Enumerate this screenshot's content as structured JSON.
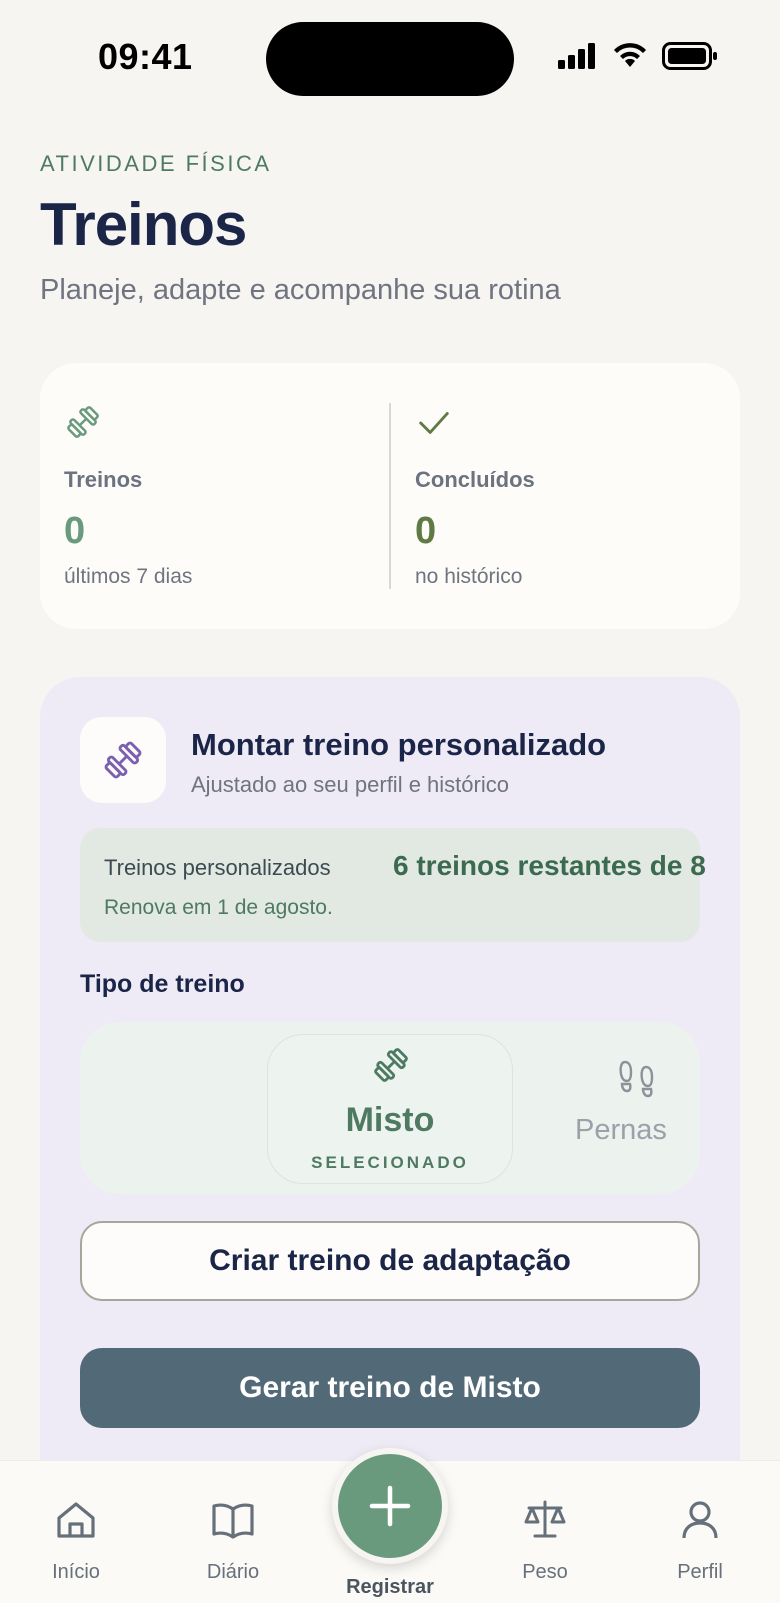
{
  "status_bar": {
    "time": "09:41"
  },
  "header": {
    "eyebrow": "ATIVIDADE FÍSICA",
    "title": "Treinos",
    "subtitle": "Planeje, adapte e acompanhe sua rotina"
  },
  "stats": [
    {
      "icon": "dumbbell-icon",
      "label": "Treinos",
      "value": "0",
      "caption": "últimos 7 dias",
      "color": "#6a9a7e"
    },
    {
      "icon": "check-icon",
      "label": "Concluídos",
      "value": "0",
      "caption": "no histórico",
      "color": "#5f7a44"
    }
  ],
  "builder": {
    "icon": "dumbbell-icon",
    "title": "Montar treino personalizado",
    "subtitle": "Ajustado ao seu perfil e histórico",
    "quota": {
      "label": "Treinos personalizados",
      "value": "6 treinos restantes de 8",
      "renew": "Renova em 1 de agosto."
    },
    "type_heading": "Tipo de treino",
    "types": [
      {
        "name": "Misto",
        "status": "SELECIONADO",
        "icon": "dumbbell-icon",
        "selected": true
      },
      {
        "name": "Pernas",
        "icon": "footprints-icon",
        "selected": false
      }
    ],
    "adapt_button": "Criar treino de adaptação",
    "generate_button": "Gerar treino de Misto"
  },
  "tab_bar": {
    "items": [
      {
        "label": "Início",
        "icon": "home-icon"
      },
      {
        "label": "Diário",
        "icon": "book-icon"
      },
      {
        "label": "Peso",
        "icon": "scale-icon"
      },
      {
        "label": "Perfil",
        "icon": "user-icon"
      }
    ],
    "fab_label": "Registrar",
    "fab_icon": "plus-icon"
  },
  "colors": {
    "accent_green": "#6a9a7e",
    "navy": "#1a2547",
    "slate_button": "#526978",
    "lavender_card": "#efebf6"
  }
}
